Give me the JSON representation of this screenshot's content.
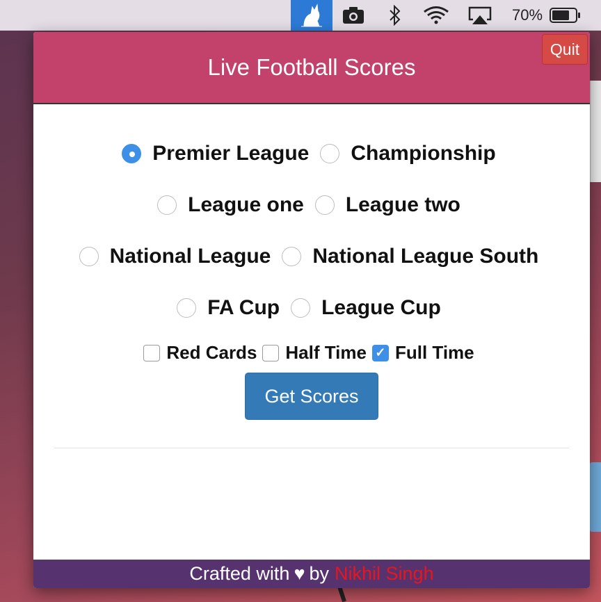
{
  "menubar": {
    "battery_percent": "70%",
    "icons": [
      "cat-app-icon",
      "camera-icon",
      "bluetooth-icon",
      "wifi-icon",
      "airplay-icon",
      "battery-icon"
    ]
  },
  "app": {
    "title": "Live Football Scores",
    "quit_label": "Quit",
    "header_color": "#c3426b",
    "leagues": [
      {
        "label": "Premier League",
        "selected": true
      },
      {
        "label": "Championship",
        "selected": false
      },
      {
        "label": "League one",
        "selected": false
      },
      {
        "label": "League two",
        "selected": false
      },
      {
        "label": "National League",
        "selected": false
      },
      {
        "label": "National League South",
        "selected": false
      },
      {
        "label": "FA Cup",
        "selected": false
      },
      {
        "label": "League Cup",
        "selected": false
      }
    ],
    "filters": [
      {
        "label": "Red Cards",
        "checked": false
      },
      {
        "label": "Half Time",
        "checked": false
      },
      {
        "label": "Full Time",
        "checked": true
      }
    ],
    "get_scores_label": "Get Scores",
    "footer": {
      "prefix": "Crafted with",
      "heart": "♥",
      "by": "by",
      "author": "Nikhil Singh"
    }
  }
}
